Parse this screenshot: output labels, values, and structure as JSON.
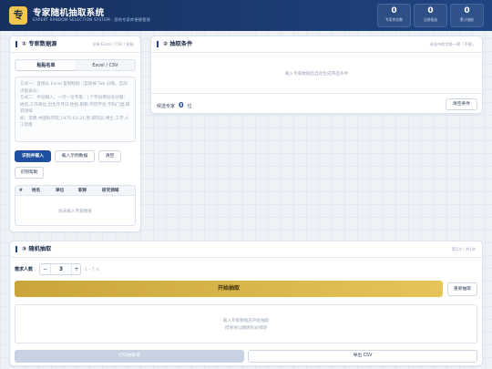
{
  "header": {
    "logo_char": "专",
    "title": "专家随机抽取系统",
    "subtitle": "EXPERT RANDOM SELECTION SYSTEM · 您的专家库便捷管理",
    "stats": [
      {
        "value": "0",
        "label": "专家库总数"
      },
      {
        "value": "0",
        "label": "当前候选"
      },
      {
        "value": "0",
        "label": "累计抽取"
      }
    ]
  },
  "source": {
    "title": "① 专家数据源",
    "hint": "支持 Excel / CSV / 粘贴",
    "tabs": [
      "粘贴名单",
      "Excel / CSV"
    ],
    "placeholder": "方式一：直接从 Excel 复制粘贴（自动按 Tab 分隔，自动识别表头）\n方式二：手动输入，一行一位专家，| 个字段用逗号分隔：\n姓名,工作单位,出生年月日,性别,职称,学历学位,学科门类,研究领域\n如：李明,中国科学院,1975-03-21,男,研究员,博士,工学,人工智能",
    "buttons": {
      "parse": "识别并载入",
      "sample": "载入示例数据",
      "clear": "清空",
      "help": "识别帮助"
    },
    "table": {
      "columns": [
        "#",
        "姓名",
        "单位",
        "职称",
        "研究领域"
      ],
      "empty": "尚未载入专家数据"
    }
  },
  "filter": {
    "title": "② 抽取条件",
    "hint": "未选中的字段一律「不限」",
    "empty": "载入专家数据后自动生成筛选条件",
    "candidates_label": "候选专家",
    "candidates_count": "0",
    "candidates_unit": "位",
    "clear_button": "清空条件"
  },
  "draw": {
    "title": "③ 随机抽取",
    "hint": "第1次 / 共1次",
    "count_label": "需求人数",
    "count_value": "3",
    "count_range": "1 – 7 人",
    "minus": "−",
    "plus": "+",
    "start_button": "开始抽取",
    "reset_button": "重新抽取",
    "result_line1": "载入专家数据后开始抽取",
    "result_line2": "结果将以翻牌形式揭晓",
    "print_button": "打印抽取单",
    "export_button": "导出 CSV"
  }
}
